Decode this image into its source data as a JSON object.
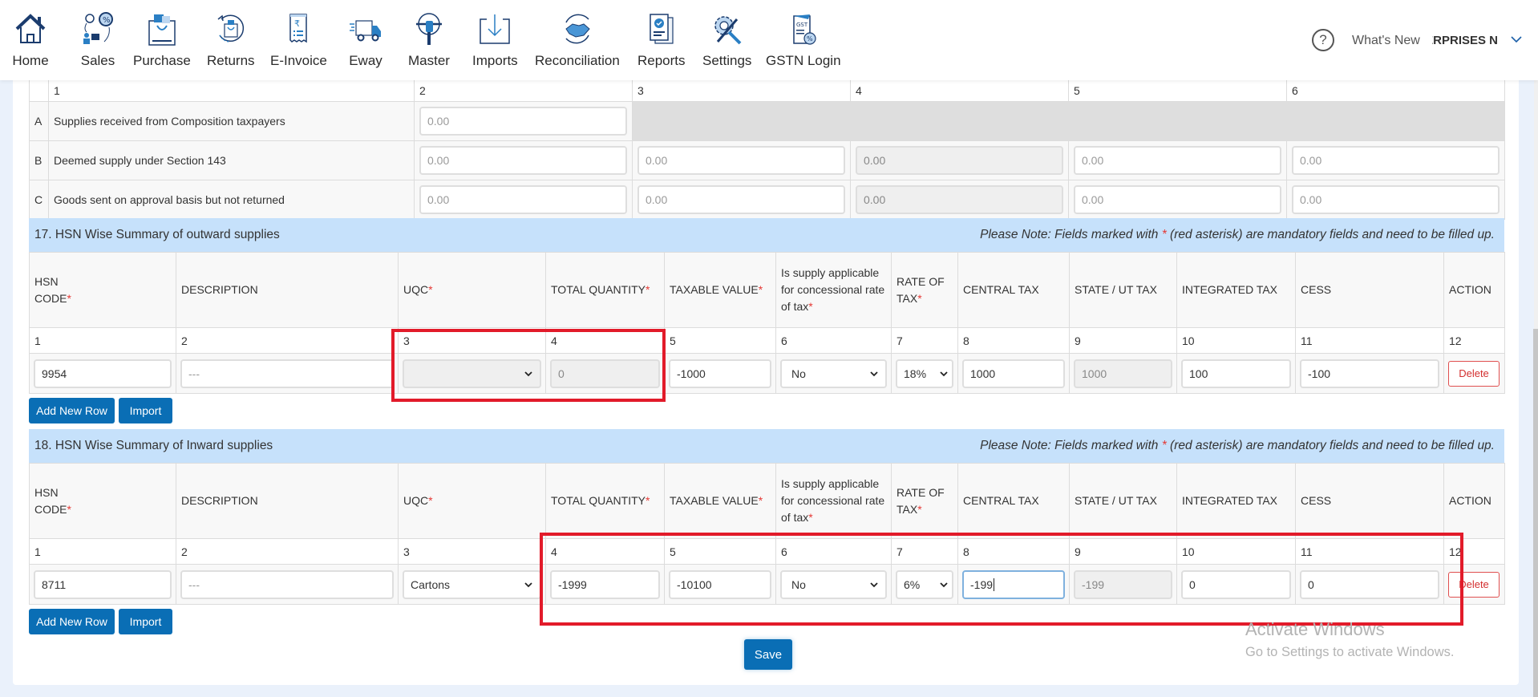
{
  "nav": {
    "items": [
      {
        "label": "Home",
        "icon": "home-icon"
      },
      {
        "label": "Sales",
        "icon": "sales-icon"
      },
      {
        "label": "Purchase",
        "icon": "purchase-bag-icon"
      },
      {
        "label": "Returns",
        "icon": "returns-icon"
      },
      {
        "label": "E-Invoice",
        "icon": "e-invoice-receipt-icon"
      },
      {
        "label": "Eway",
        "icon": "eway-truck-icon"
      },
      {
        "label": "Master",
        "icon": "master-icon"
      },
      {
        "label": "Imports",
        "icon": "imports-download-icon"
      },
      {
        "label": "Reconciliation",
        "icon": "reconciliation-handshake-icon"
      },
      {
        "label": "Reports",
        "icon": "reports-icon"
      },
      {
        "label": "Settings",
        "icon": "settings-tools-icon"
      },
      {
        "label": "GSTN Login",
        "icon": "gstn-login-icon"
      }
    ],
    "help_glyph": "?",
    "whats_new": "What's New",
    "company": "ENTERPRISES N"
  },
  "top_table": {
    "col_numbers": [
      "1",
      "2",
      "3",
      "4",
      "5",
      "6"
    ],
    "rows": [
      {
        "letter": "A",
        "label": "Supplies received from Composition taxpayers",
        "values": [
          "0.00"
        ]
      },
      {
        "letter": "B",
        "label": "Deemed supply under Section 143",
        "values": [
          "0.00",
          "0.00",
          "0.00",
          "0.00",
          "0.00"
        ]
      },
      {
        "letter": "C",
        "label": "Goods sent on approval basis but not returned",
        "values": [
          "0.00",
          "0.00",
          "0.00",
          "0.00",
          "0.00"
        ]
      }
    ]
  },
  "note": {
    "prefix": "Please Note: Fields marked with ",
    "asterisk": "*",
    "suffix": " (red asterisk) are mandatory fields and need to be filled up."
  },
  "columns": {
    "hsn_1": "HSN",
    "hsn_2": "CODE",
    "description": "DESCRIPTION",
    "uqc": "UQC",
    "total_quantity": "TOTAL QUANTITY",
    "taxable_value": "TAXABLE VALUE",
    "concessional": "Is supply applicable for concessional rate of tax",
    "rate_1": "RATE OF",
    "rate_2": "TAX",
    "central_tax": "CENTRAL TAX",
    "state_tax": "STATE / UT TAX",
    "integrated_tax": "INTEGRATED TAX",
    "cess": "CESS",
    "action": "ACTION",
    "req": "*",
    "numbers": [
      "1",
      "2",
      "3",
      "4",
      "5",
      "6",
      "7",
      "8",
      "9",
      "10",
      "11",
      "12"
    ]
  },
  "section17": {
    "title": "17. HSN Wise Summary of outward supplies",
    "row": {
      "hsn_code": "9954",
      "description": "---",
      "uqc": "",
      "total_quantity": "0",
      "taxable_value": "-1000",
      "concessional": "No",
      "rate": "18%",
      "central_tax": "1000",
      "state_tax": "1000",
      "integrated_tax": "100",
      "cess": "-100",
      "action": "Delete"
    }
  },
  "section18": {
    "title": "18. HSN Wise Summary of Inward supplies",
    "row": {
      "hsn_code": "8711",
      "description": "---",
      "uqc": "Cartons",
      "total_quantity": "-1999",
      "taxable_value": "-10100",
      "concessional": "No",
      "rate": "6%",
      "central_tax": "-199",
      "state_tax": "-199",
      "integrated_tax": "0",
      "cess": "0",
      "action": "Delete"
    }
  },
  "buttons": {
    "add_new_row": "Add New Row",
    "import": "Import",
    "save": "Save"
  },
  "watermark": {
    "line1": "Activate Windows",
    "line2": "Go to Settings to activate Windows."
  },
  "colors": {
    "primary": "#0a6eb5",
    "section_header": "#c6e1fb",
    "required": "#e53935",
    "highlight_box": "#e21b2a"
  }
}
